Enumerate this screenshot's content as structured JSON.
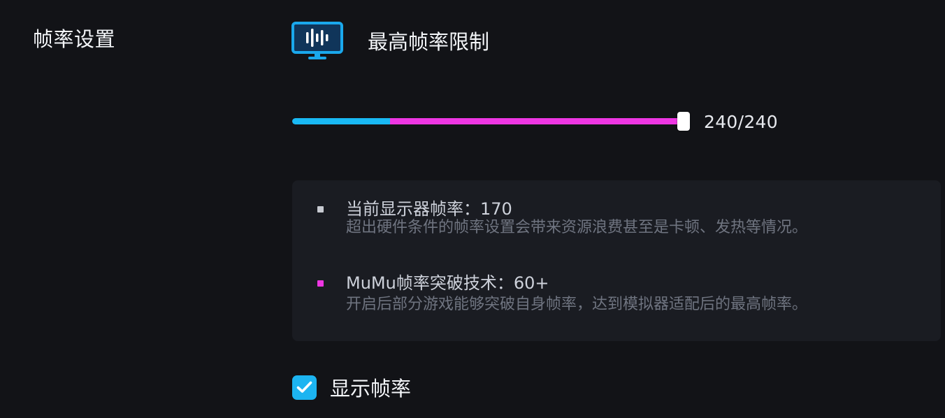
{
  "section": {
    "title": "帧率设置"
  },
  "max_fps": {
    "title": "最高帧率限制",
    "icon": "monitor-soundwave-icon",
    "slider": {
      "value": 240,
      "max": 240,
      "display_refresh": 170,
      "readout": "240/240"
    }
  },
  "info": {
    "items": [
      {
        "headline": "当前显示器帧率：170",
        "description": "超出硬件条件的帧率设置会带来资源浪费甚至是卡顿、发热等情况。",
        "bullet_color": "#c7cad1"
      },
      {
        "headline": "MuMu帧率突破技术：60+",
        "description": "开启后部分游戏能够突破自身帧率，达到模拟器适配后的最高帧率。",
        "bullet_color": "#ee36e3"
      }
    ]
  },
  "show_fps": {
    "label": "显示帧率",
    "checked": true
  },
  "colors": {
    "background": "#121317",
    "panel": "#1a1c22",
    "accent_blue": "#19b9f4",
    "accent_pink": "#ee36e3",
    "text_primary": "#f3f5f8",
    "text_secondary": "#6f7480"
  }
}
